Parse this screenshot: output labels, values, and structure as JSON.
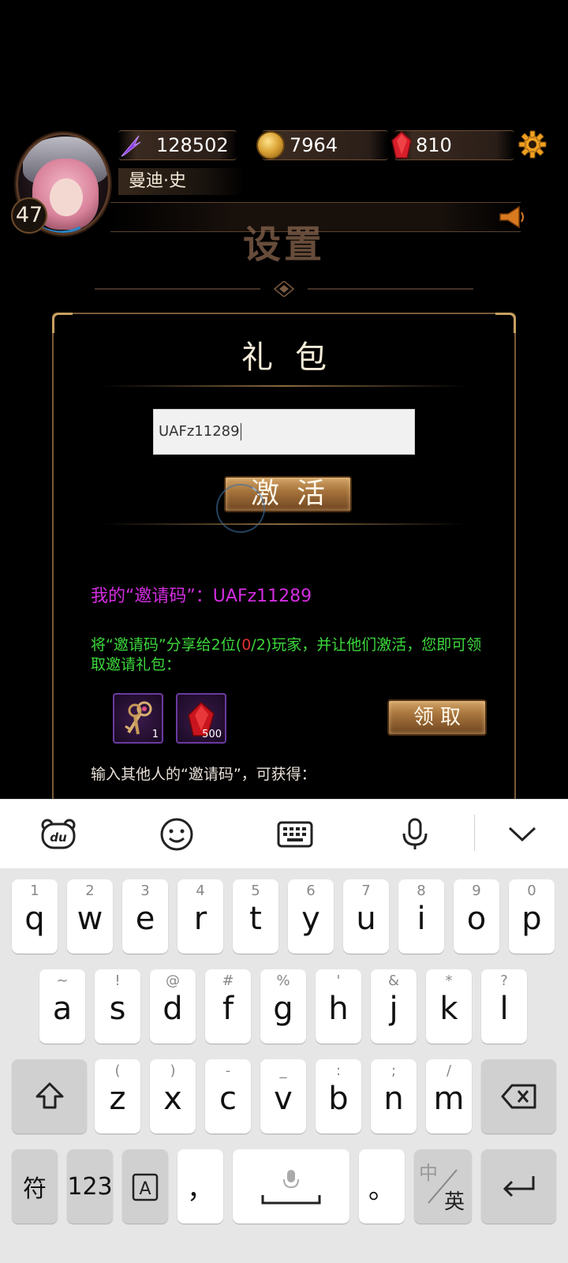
{
  "hud": {
    "power": "128502",
    "gold": "7964",
    "gems": "810",
    "player_name": "曼迪·史",
    "level": "47"
  },
  "screen_title": "设置",
  "gift_panel": {
    "title": "礼包",
    "code_input_value": "UAFz11289",
    "activate_label": "激活",
    "my_invite_code": "我的“邀请码”：UAFz11289",
    "share_text_a": "将“邀请码”分享给2位(",
    "share_progress": "0",
    "share_text_b": "/2)玩家，并让他们激活，您即可领取邀请礼包：",
    "rewards": [
      {
        "icon": "keys-icon",
        "count": "1"
      },
      {
        "icon": "red-gem-icon",
        "count": "500"
      }
    ],
    "claim_label": "领取",
    "input_others_label": "输入其他人的“邀请码”，可获得："
  },
  "keyboard": {
    "toolbar_icons": [
      "baidu-du-icon",
      "emoji-icon",
      "keyboard-icon",
      "microphone-icon",
      "collapse-chevron-icon"
    ],
    "row1": [
      {
        "main": "q",
        "sub": "1"
      },
      {
        "main": "w",
        "sub": "2"
      },
      {
        "main": "e",
        "sub": "3"
      },
      {
        "main": "r",
        "sub": "4"
      },
      {
        "main": "t",
        "sub": "5"
      },
      {
        "main": "y",
        "sub": "6"
      },
      {
        "main": "u",
        "sub": "7"
      },
      {
        "main": "i",
        "sub": "8"
      },
      {
        "main": "o",
        "sub": "9"
      },
      {
        "main": "p",
        "sub": "0"
      }
    ],
    "row2": [
      {
        "main": "a",
        "sub": "~"
      },
      {
        "main": "s",
        "sub": "!"
      },
      {
        "main": "d",
        "sub": "@"
      },
      {
        "main": "f",
        "sub": "#"
      },
      {
        "main": "g",
        "sub": "%"
      },
      {
        "main": "h",
        "sub": "'"
      },
      {
        "main": "j",
        "sub": "&"
      },
      {
        "main": "k",
        "sub": "*"
      },
      {
        "main": "l",
        "sub": "?"
      }
    ],
    "row3": [
      {
        "main": "z",
        "sub": "("
      },
      {
        "main": "x",
        "sub": ")"
      },
      {
        "main": "c",
        "sub": "-"
      },
      {
        "main": "v",
        "sub": "_"
      },
      {
        "main": "b",
        "sub": ":"
      },
      {
        "main": "n",
        "sub": ";"
      },
      {
        "main": "m",
        "sub": "/"
      }
    ],
    "symbols_label": "符",
    "numbers_label": "123",
    "comma_label": "，",
    "period_label": "。",
    "lang_cn": "中",
    "lang_en": "英"
  }
}
